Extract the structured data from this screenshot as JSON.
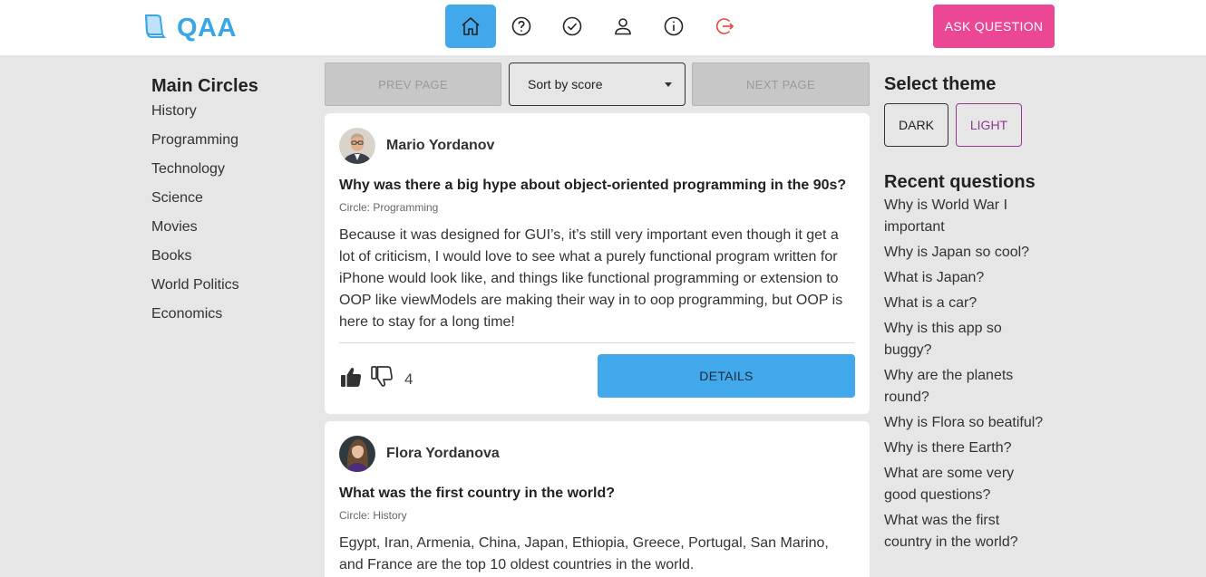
{
  "header": {
    "logo_text": "QAA",
    "nav": [
      {
        "name": "home-icon",
        "active": true
      },
      {
        "name": "question-icon",
        "active": false
      },
      {
        "name": "check-icon",
        "active": false
      },
      {
        "name": "user-icon",
        "active": false
      },
      {
        "name": "info-icon",
        "active": false
      },
      {
        "name": "logout-icon",
        "active": false
      }
    ],
    "ask_button": "ASK QUESTION"
  },
  "sidebar": {
    "title": "Main Circles",
    "items": [
      "History",
      "Programming",
      "Technology",
      "Science",
      "Movies",
      "Books",
      "World Politics",
      "Economics"
    ]
  },
  "pager": {
    "prev_label": "PREV PAGE",
    "next_label": "NEXT PAGE",
    "sort_value": "Sort by score"
  },
  "questions": [
    {
      "author": "Mario Yordanov",
      "title": "Why was there a big hype about object-oriented programming in the 90s?",
      "circle": "Circle: Programming",
      "body": "Because it was designed for GUI’s, it’s still very important even though it get a lot of criticism, I would love to see what a purely functional program written for iPhone would look like, and things like functional programming or extension to OOP like viewModels are making their way in to oop programming, but OOP is here to stay for a long time!",
      "score": "4",
      "details_label": "DETAILS"
    },
    {
      "author": "Flora Yordanova",
      "title": "What was the first country in the world?",
      "circle": "Circle: History",
      "body": "Egypt, Iran, Armenia, China, Japan, Ethiopia, Greece, Portugal, San Marino, and France are the top 10 oldest countries in the world."
    }
  ],
  "theme": {
    "title": "Select theme",
    "dark_label": "DARK",
    "light_label": "LIGHT"
  },
  "recent": {
    "title": "Recent questions",
    "items": [
      "Why is World War I important",
      "Why is Japan so cool?",
      "What is Japan?",
      "What is a car?",
      "Why is this app so buggy?",
      "Why are the planets round?",
      "Why is Flora so beatiful?",
      "Why is there Earth?",
      "What are some very good questions?",
      "What was the first country in the world?"
    ]
  },
  "colors": {
    "accent_blue": "#42a8ec",
    "logo_blue": "#3aa6e6",
    "ask_pink": "#ec4795",
    "light_purple": "#8e3a8e",
    "logout_red": "#e0463c"
  }
}
